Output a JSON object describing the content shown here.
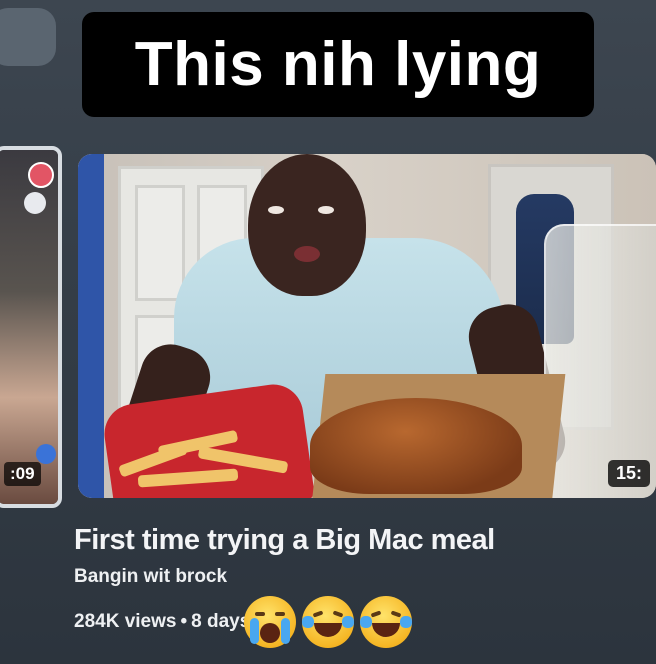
{
  "caption": {
    "text": "This nih lying"
  },
  "side_card": {
    "duration": ":09"
  },
  "video": {
    "duration": "15:",
    "title": "First time trying a Big Mac meal",
    "channel": "Bangin wit brock",
    "views": "284K views",
    "separator": "•",
    "age": "8 days"
  },
  "reaction_emojis": [
    "loudly-crying-face",
    "tears-of-joy-face",
    "tears-of-joy-face"
  ],
  "colors": {
    "background": "#343d47",
    "caption_box": "#000000",
    "caption_text": "#ffffff",
    "text": "#f3f4f6"
  }
}
